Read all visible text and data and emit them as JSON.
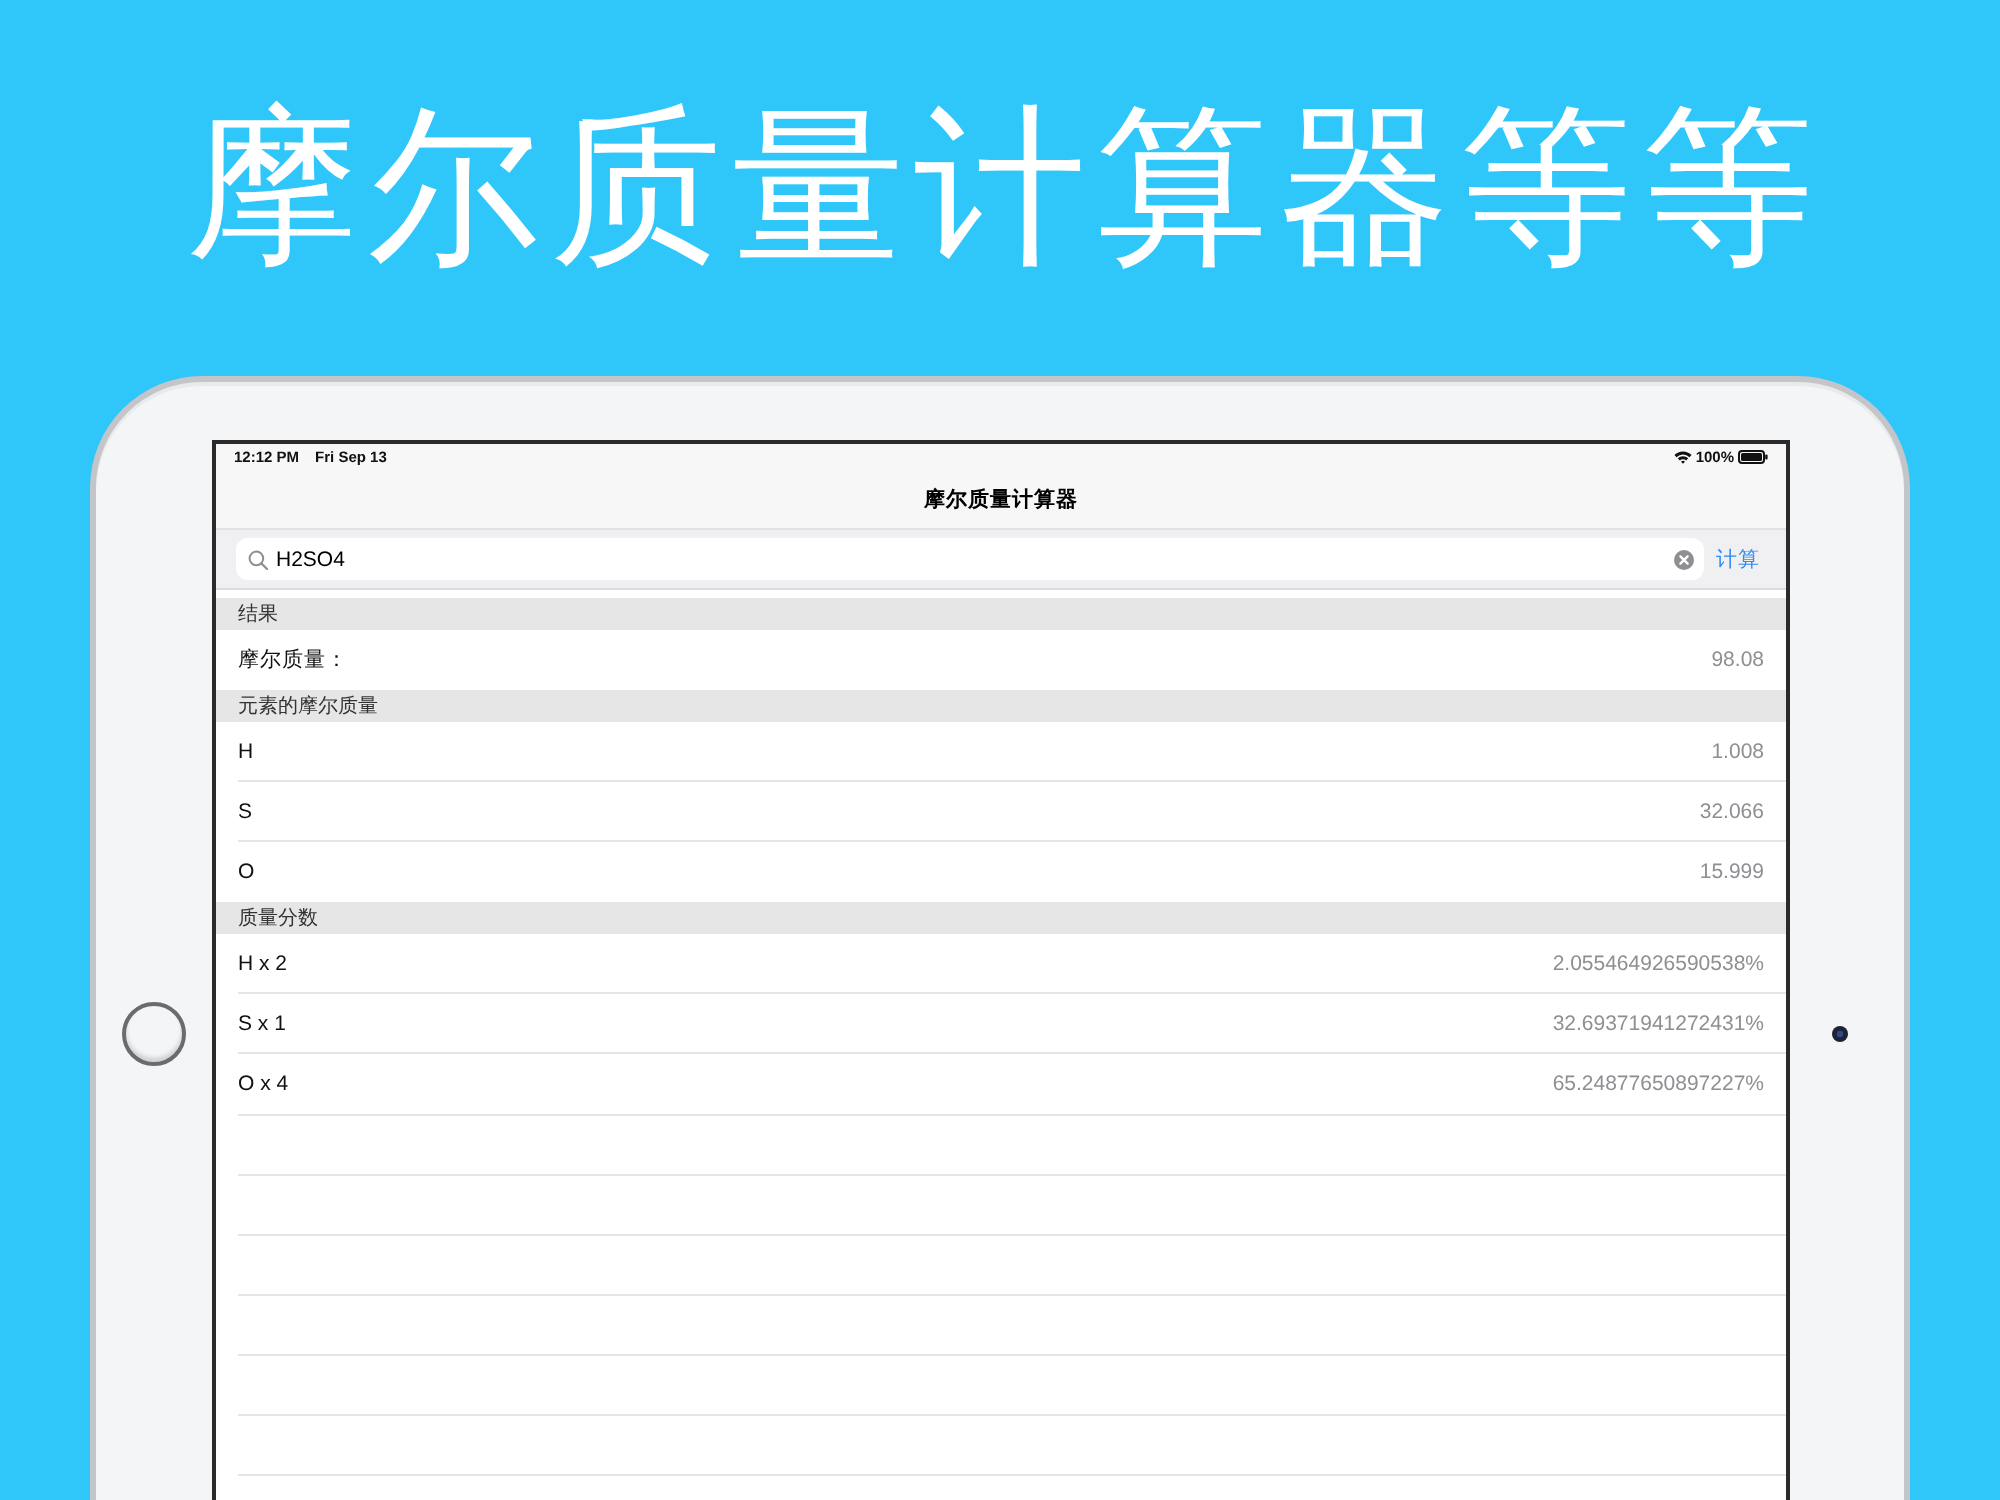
{
  "headline": "摩尔质量计算器等等",
  "status_bar": {
    "time": "12:12 PM",
    "date": "Fri Sep 13",
    "battery": "100%"
  },
  "nav_bar": {
    "title": "摩尔质量计算器"
  },
  "search": {
    "value": "H2SO4",
    "button": "计算"
  },
  "sections": [
    {
      "title": "结果",
      "rows": [
        {
          "label": "摩尔质量：",
          "value": "98.08"
        }
      ]
    },
    {
      "title": "元素的摩尔质量",
      "rows": [
        {
          "label": "H",
          "value": "1.008"
        },
        {
          "label": "S",
          "value": "32.066"
        },
        {
          "label": "O",
          "value": "15.999"
        }
      ]
    },
    {
      "title": "质量分数",
      "rows": [
        {
          "label": "H x 2",
          "value": "2.055464926590538%"
        },
        {
          "label": "S x 1",
          "value": "32.69371941272431%"
        },
        {
          "label": "O x 4",
          "value": "65.24877650897227%"
        }
      ]
    }
  ]
}
